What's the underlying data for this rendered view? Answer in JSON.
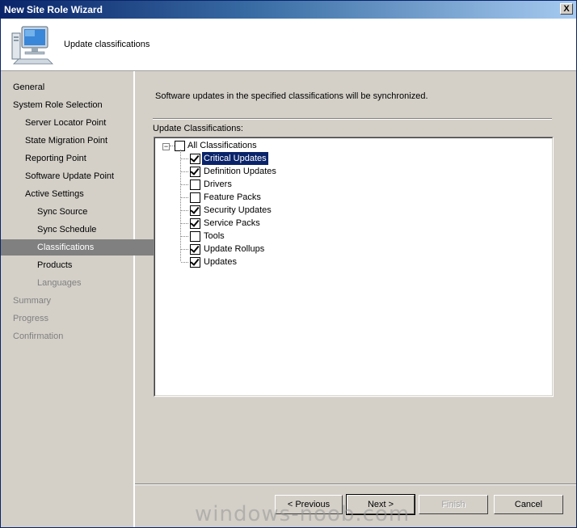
{
  "window": {
    "title": "New Site Role Wizard",
    "close_label": "X"
  },
  "header": {
    "title": "Update classifications",
    "icon": "computer-icon"
  },
  "nav": [
    {
      "label": "General",
      "level": 0,
      "state": "normal"
    },
    {
      "label": "System Role Selection",
      "level": 0,
      "state": "normal"
    },
    {
      "label": "Server Locator Point",
      "level": 1,
      "state": "normal"
    },
    {
      "label": "State Migration Point",
      "level": 1,
      "state": "normal"
    },
    {
      "label": "Reporting Point",
      "level": 1,
      "state": "normal"
    },
    {
      "label": "Software Update Point",
      "level": 1,
      "state": "normal"
    },
    {
      "label": "Active Settings",
      "level": 1,
      "state": "normal"
    },
    {
      "label": "Sync Source",
      "level": 2,
      "state": "normal"
    },
    {
      "label": "Sync Schedule",
      "level": 2,
      "state": "normal"
    },
    {
      "label": "Classifications",
      "level": 2,
      "state": "selected"
    },
    {
      "label": "Products",
      "level": 2,
      "state": "normal"
    },
    {
      "label": "Languages",
      "level": 2,
      "state": "disabled"
    },
    {
      "label": "Summary",
      "level": 0,
      "state": "disabled"
    },
    {
      "label": "Progress",
      "level": 0,
      "state": "disabled"
    },
    {
      "label": "Confirmation",
      "level": 0,
      "state": "disabled"
    }
  ],
  "content": {
    "description": "Software updates in the specified classifications will be synchronized.",
    "tree_label": "Update Classifications:",
    "root": {
      "label": "All Classifications",
      "checked": false,
      "expander": "−"
    },
    "items": [
      {
        "label": "Critical Updates",
        "checked": true,
        "selected": true
      },
      {
        "label": "Definition Updates",
        "checked": true,
        "selected": false
      },
      {
        "label": "Drivers",
        "checked": false,
        "selected": false
      },
      {
        "label": "Feature Packs",
        "checked": false,
        "selected": false
      },
      {
        "label": "Security Updates",
        "checked": true,
        "selected": false
      },
      {
        "label": "Service Packs",
        "checked": true,
        "selected": false
      },
      {
        "label": "Tools",
        "checked": false,
        "selected": false
      },
      {
        "label": "Update Rollups",
        "checked": true,
        "selected": false
      },
      {
        "label": "Updates",
        "checked": true,
        "selected": false
      }
    ]
  },
  "buttons": {
    "previous": "< Previous",
    "next": "Next >",
    "finish": "Finish",
    "cancel": "Cancel"
  },
  "watermark": "windows-noob.com"
}
